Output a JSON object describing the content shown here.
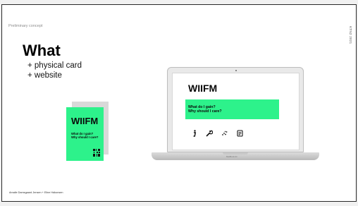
{
  "slide": {
    "header_label": "Preliminary concept",
    "vertical_code": "KTN2 2021",
    "title": "What",
    "bullets": [
      "+ physical card",
      "+ website"
    ],
    "footer": "Amalie Damsgaard Jensen + Eline Hákonsen"
  },
  "card": {
    "title": "WIIFM",
    "line1": "What do I gain?",
    "line2": "Why should I care?"
  },
  "laptop": {
    "brand": "MacBook Air",
    "screen_title": "WIIFM",
    "banner_line1": "What do I gain?",
    "banner_line2": "Why should I care?",
    "icons": [
      "info-icon",
      "wrench-icon",
      "scatter-icon",
      "document-icon"
    ]
  },
  "colors": {
    "accent_green": "#2df28b",
    "text": "#0a0a0a"
  }
}
